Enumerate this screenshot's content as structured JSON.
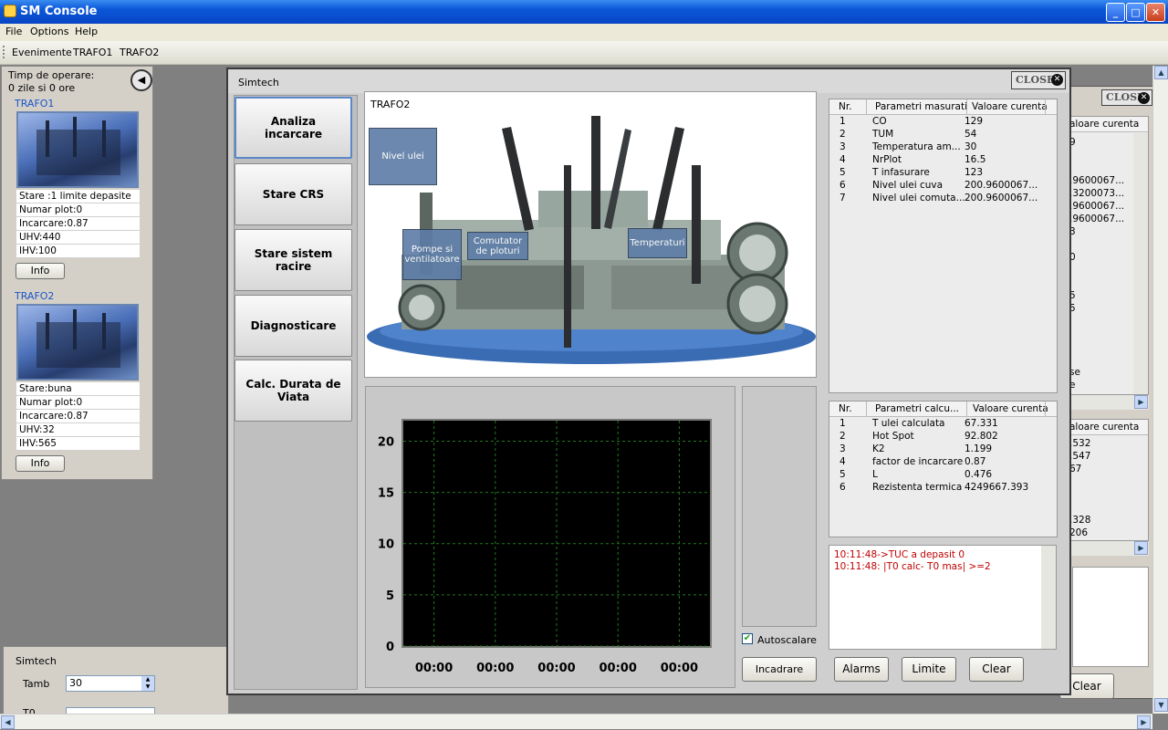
{
  "window": {
    "title": "SM Console"
  },
  "menu": [
    "File",
    "Options",
    "Help"
  ],
  "toolbar": [
    "Evenimente",
    "TRAFO1",
    "TRAFO2"
  ],
  "left_panel": {
    "operating_time_label": "Timp de operare:",
    "operating_time_value": "0 zile si 0 ore",
    "trafos": [
      {
        "name": "TRAFO1",
        "lines": [
          "Stare :1 limite depasite",
          "Numar plot:0",
          "Incarcare:0.87",
          "UHV:440",
          "IHV:100"
        ],
        "button": "Info"
      },
      {
        "name": "TRAFO2",
        "lines": [
          "Stare:buna",
          "Numar plot:0",
          "Incarcare:0.87",
          "UHV:32",
          "IHV:565"
        ],
        "button": "Info"
      }
    ]
  },
  "bottom_panel": {
    "title": "Simtech",
    "tamb_label": "Tamb",
    "tamb_value": "30",
    "t0_label": "T0"
  },
  "sim": {
    "title": "Simtech",
    "close_label": "CLOSE",
    "side_buttons": [
      "Analiza incarcare",
      "Stare CRS",
      "Stare sistem racire",
      "Diagnosticare",
      "Calc. Durata de Viata"
    ],
    "image_label": "TRAFO2",
    "bubbles": [
      "Nivel ulei",
      "Pompe si ventilatoare",
      "Comutator de ploturi",
      "Temperaturi"
    ],
    "autoscale_label": "Autoscalare",
    "fit_button": "Incadrare",
    "buttons": [
      "Alarms",
      "Limite",
      "Clear"
    ],
    "measured": {
      "headers": [
        "Nr.",
        "Parametri masurati",
        "Valoare curenta"
      ],
      "rows": [
        [
          "1",
          "CO",
          "129"
        ],
        [
          "2",
          "TUM",
          "54"
        ],
        [
          "3",
          "Temperatura am...",
          "30"
        ],
        [
          "4",
          "NrPlot",
          "16.5"
        ],
        [
          "5",
          "T infasurare",
          "123"
        ],
        [
          "6",
          "Nivel ulei cuva",
          "200.9600067..."
        ],
        [
          "7",
          "Nivel ulei comuta...",
          "200.9600067..."
        ]
      ]
    },
    "calculated": {
      "headers": [
        "Nr.",
        "Parametri calcu...",
        "Valoare curenta"
      ],
      "rows": [
        [
          "1",
          "T ulei calculata",
          "67.331"
        ],
        [
          "2",
          "Hot Spot",
          "92.802"
        ],
        [
          "3",
          "K2",
          "1.199"
        ],
        [
          "4",
          "factor de incarcare",
          "0.87"
        ],
        [
          "5",
          "L",
          "0.476"
        ],
        [
          "6",
          "Rezistenta termica",
          "4249667.393"
        ]
      ]
    },
    "alarms": [
      "10:11:48->TUC a depasit 0",
      "10:11:48: |T0 calc- T0 mas| >=2"
    ]
  },
  "chart_data": {
    "type": "line",
    "title": "",
    "xlabel": "",
    "ylabel": "",
    "ylim": [
      0,
      22
    ],
    "y_ticks": [
      0,
      5,
      10,
      15,
      20
    ],
    "x_ticks": [
      "00:00",
      "00:00",
      "00:00",
      "00:00",
      "00:00"
    ],
    "grid": true,
    "series": []
  },
  "back_window": {
    "close_label": "CLOSE",
    "header1": "aloare curenta",
    "values1": [
      "9",
      ".9600067...",
      ".3200073...",
      ".9600067...",
      ".9600067...",
      "3",
      "0",
      "5",
      "5",
      "se",
      "e"
    ],
    "header2": "aloare curenta",
    "values2": [
      ".532",
      ".547",
      "67",
      ".328",
      "206"
    ],
    "clear_label": "Clear"
  },
  "colors": {
    "titlebar": "#0a56d8",
    "alarm_text": "#c00000",
    "chart_bg": "#000000",
    "grid": "#1e7a1e",
    "trafo_link": "#1a55c8"
  }
}
